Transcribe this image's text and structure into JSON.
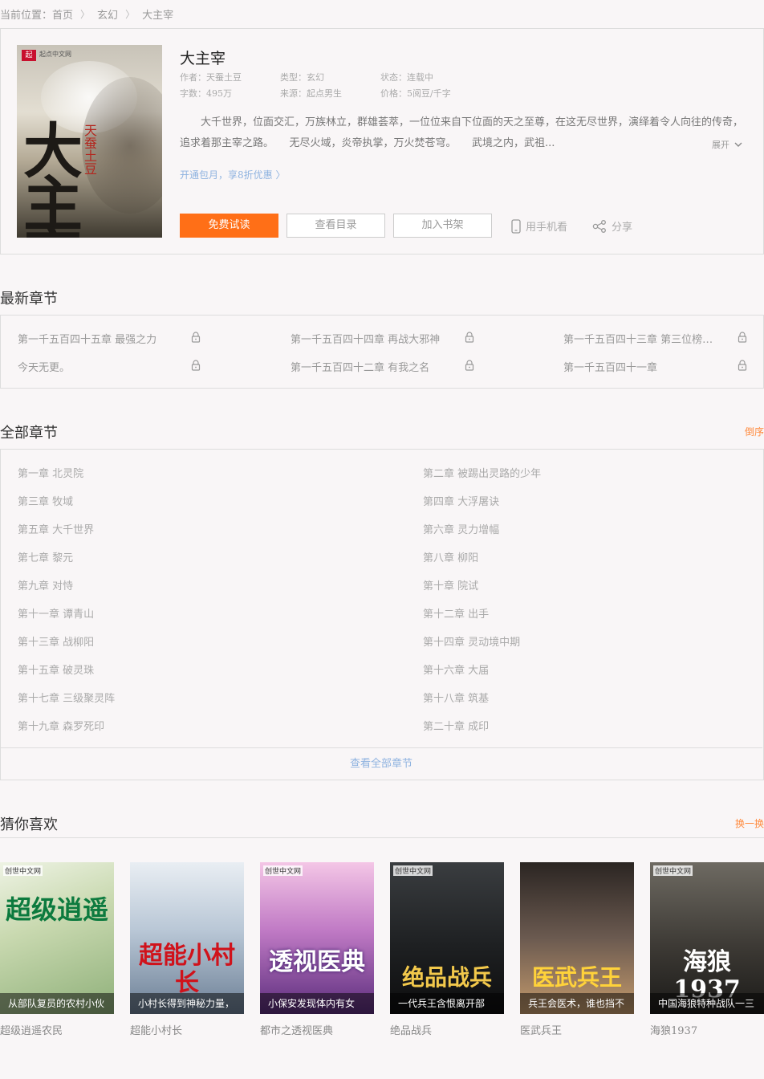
{
  "breadcrumb": {
    "label": "当前位置：",
    "items": [
      "首页",
      "玄幻",
      "大主宰"
    ]
  },
  "book": {
    "title": "大主宰",
    "cover_text": "大主宰",
    "cover_author": "天蚕土豆",
    "cover_publisher": "起点中文网",
    "author": "作者：天蚕土豆",
    "category": "类型：玄幻",
    "status": "状态：连载中",
    "word_count": "字数：495万",
    "source": "来源：起点男生",
    "price": "价格：5阅豆/千字",
    "description": "大千世界，位面交汇，万族林立，群雄荟萃，一位位来自下位面的天之至尊，在这无尽世界，演绎着令人向往的传奇，追求着那主宰之路。　　无尽火域，炎帝执掌，万火焚苍穹。　　武境之内，武祖...",
    "expand_label": "展开",
    "promo": "开通包月，享8折优惠 〉",
    "buttons": {
      "read": "免费试读",
      "catalog": "查看目录",
      "shelf": "加入书架"
    },
    "mobile_label": "用手机看",
    "share_label": "分享"
  },
  "latest": {
    "title": "最新章节",
    "items": [
      "第一千五百四十五章 最强之力",
      "第一千五百四十四章 再战大邪神",
      "第一千五百四十三章 第三位榜…",
      "今天无更。",
      "第一千五百四十二章 有我之名",
      "第一千五百四十一章"
    ]
  },
  "all_chapters": {
    "title": "全部章节",
    "order_label": "倒序",
    "items": [
      "第一章 北灵院",
      "第二章 被踢出灵路的少年",
      "第三章 牧域",
      "第四章 大浮屠诀",
      "第五章 大千世界",
      "第六章 灵力增幅",
      "第七章 黎元",
      "第八章 柳阳",
      "第九章 对恃",
      "第十章 院试",
      "第十一章 谭青山",
      "第十二章 出手",
      "第十三章 战柳阳",
      "第十四章 灵动境中期",
      "第十五章 破灵珠",
      "第十六章 大届",
      "第十七章 三级聚灵阵",
      "第十八章 筑基",
      "第十九章 森罗死印",
      "第二十章 成印"
    ],
    "view_all": "查看全部章节"
  },
  "recommend": {
    "title": "猜你喜欢",
    "swap_label": "换一换",
    "items": [
      {
        "name": "超级逍遥农民",
        "cover_text": "超级逍遥",
        "caption": "从部队复员的农村小伙",
        "publisher": "创世中文网"
      },
      {
        "name": "超能小村长",
        "cover_text": "超能小村长",
        "caption": "小村长得到神秘力量，",
        "publisher": ""
      },
      {
        "name": "都市之透视医典",
        "cover_text": "透视医典",
        "caption": "小保安发现体内有女",
        "publisher": "创世中文网"
      },
      {
        "name": "绝品战兵",
        "cover_text": "绝品战兵",
        "caption": "一代兵王含恨离开部",
        "publisher": "创世中文网"
      },
      {
        "name": "医武兵王",
        "cover_text": "医武兵王",
        "caption": "兵王会医术，谁也挡不",
        "publisher": ""
      },
      {
        "name": "海狼1937",
        "cover_text": "海狼1937",
        "caption": "中国海狼特种战队一三",
        "publisher": "创世中文网"
      }
    ]
  }
}
